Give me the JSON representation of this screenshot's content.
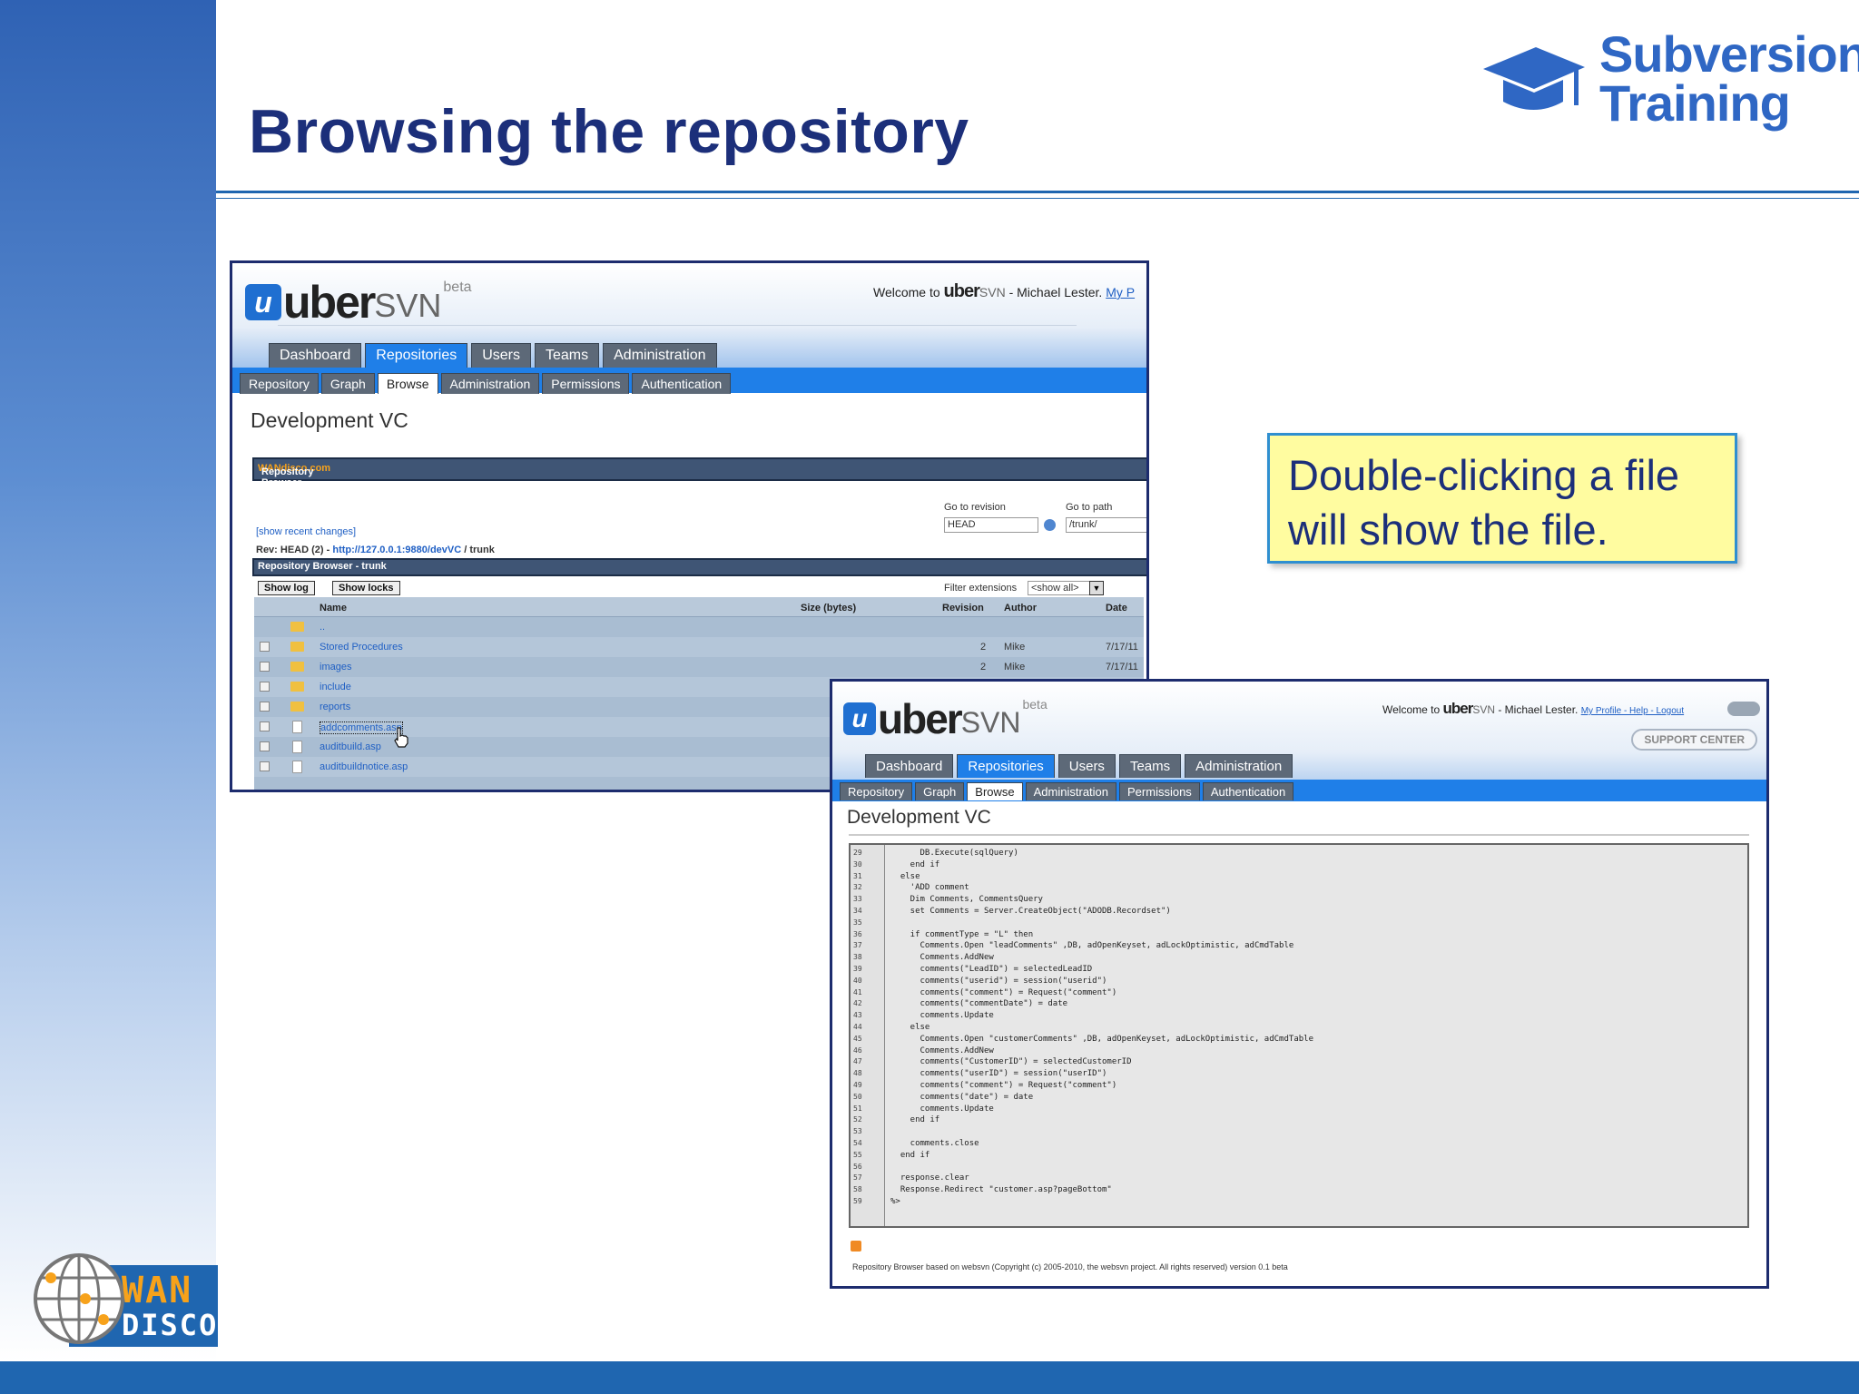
{
  "slide": {
    "title": "Browsing the repository",
    "brand_line1": "Subversion",
    "brand_line2": "Training",
    "wandisco_line1": "WAN",
    "wandisco_line2": "DISCO",
    "callout_line1": "Double-clicking a file",
    "callout_line2": "will show the file."
  },
  "colors": {
    "accent": "#1f66b0",
    "title": "#1c2f7a",
    "tab_active": "#1f7fe8",
    "callout_bg": "#fffca0"
  },
  "app": {
    "logo_u": "u",
    "logo_uber": "uber",
    "logo_svn": "SVN",
    "logo_beta": "beta",
    "welcome_prefix": "Welcome to ",
    "welcome_brand": "uber",
    "welcome_svn": "SVN",
    "welcome_user": " - Michael Lester.",
    "welcome_link": "My P",
    "welcome_links2": "My Profile - Help - Logout",
    "support": "SUPPORT CENTER",
    "main_tabs": [
      {
        "label": "Dashboard"
      },
      {
        "label": "Repositories"
      },
      {
        "label": "Users"
      },
      {
        "label": "Teams"
      },
      {
        "label": "Administration"
      }
    ],
    "sub_tabs": [
      {
        "label": "Repository"
      },
      {
        "label": "Graph"
      },
      {
        "label": "Browse"
      },
      {
        "label": "Administration"
      },
      {
        "label": "Permissions"
      },
      {
        "label": "Authentication"
      }
    ],
    "repo_name": "Development VC"
  },
  "browser": {
    "header": "Repository Browser - ",
    "header_link": "WANdisco.com",
    "go_revision_label": "Go to revision",
    "go_revision_value": "HEAD",
    "go_path_label": "Go to path",
    "go_path_value": "/trunk/",
    "show_recent": "[show recent changes]",
    "rev_prefix": "Rev: HEAD (2) - ",
    "rev_url": "http://127.0.0.1:9880/devVC",
    "rev_suffix": " / trunk",
    "trunk_header": "Repository Browser - trunk",
    "show_log": "Show log",
    "show_locks": "Show locks",
    "filter_label": "Filter extensions",
    "filter_value": "<show all>",
    "columns": {
      "name": "Name",
      "size": "Size (bytes)",
      "revision": "Revision",
      "author": "Author",
      "date": "Date"
    },
    "rows": [
      {
        "type": "folder",
        "name": "..",
        "revision": "",
        "author": "",
        "date": ""
      },
      {
        "type": "folder",
        "name": "Stored Procedures",
        "revision": "2",
        "author": "Mike",
        "date": "7/17/11"
      },
      {
        "type": "folder",
        "name": "images",
        "revision": "2",
        "author": "Mike",
        "date": "7/17/11"
      },
      {
        "type": "folder",
        "name": "include",
        "revision": "",
        "author": "",
        "date": ""
      },
      {
        "type": "folder",
        "name": "reports",
        "revision": "",
        "author": "",
        "date": ""
      },
      {
        "type": "file",
        "name": "addcomments.asp",
        "revision": "",
        "author": "",
        "date": ""
      },
      {
        "type": "file",
        "name": "auditbuild.asp",
        "revision": "",
        "author": "",
        "date": ""
      },
      {
        "type": "file",
        "name": "auditbuildnotice.asp",
        "revision": "",
        "author": "",
        "date": ""
      }
    ]
  },
  "viewer": {
    "lines": [
      {
        "n": "29",
        "t": "      DB.Execute(sqlQuery)"
      },
      {
        "n": "30",
        "t": "    end if"
      },
      {
        "n": "31",
        "t": "  else"
      },
      {
        "n": "32",
        "t": "    'ADD comment"
      },
      {
        "n": "33",
        "t": "    Dim Comments, CommentsQuery"
      },
      {
        "n": "34",
        "t": "    set Comments = Server.CreateObject(\"ADODB.Recordset\")"
      },
      {
        "n": "35",
        "t": ""
      },
      {
        "n": "36",
        "t": "    if commentType = \"L\" then"
      },
      {
        "n": "37",
        "t": "      Comments.Open \"leadComments\" ,DB, adOpenKeyset, adLockOptimistic, adCmdTable"
      },
      {
        "n": "38",
        "t": "      Comments.AddNew"
      },
      {
        "n": "39",
        "t": "      comments(\"LeadID\") = selectedLeadID"
      },
      {
        "n": "40",
        "t": "      comments(\"userid\") = session(\"userid\")"
      },
      {
        "n": "41",
        "t": "      comments(\"comment\") = Request(\"comment\")"
      },
      {
        "n": "42",
        "t": "      comments(\"commentDate\") = date"
      },
      {
        "n": "43",
        "t": "      comments.Update"
      },
      {
        "n": "44",
        "t": "    else"
      },
      {
        "n": "45",
        "t": "      Comments.Open \"customerComments\" ,DB, adOpenKeyset, adLockOptimistic, adCmdTable"
      },
      {
        "n": "46",
        "t": "      Comments.AddNew"
      },
      {
        "n": "47",
        "t": "      comments(\"CustomerID\") = selectedCustomerID"
      },
      {
        "n": "48",
        "t": "      comments(\"userID\") = session(\"userID\")"
      },
      {
        "n": "49",
        "t": "      comments(\"comment\") = Request(\"comment\")"
      },
      {
        "n": "50",
        "t": "      comments(\"date\") = date"
      },
      {
        "n": "51",
        "t": "      comments.Update"
      },
      {
        "n": "52",
        "t": "    end if"
      },
      {
        "n": "53",
        "t": ""
      },
      {
        "n": "54",
        "t": "    comments.close"
      },
      {
        "n": "55",
        "t": "  end if"
      },
      {
        "n": "56",
        "t": ""
      },
      {
        "n": "57",
        "t": "  response.clear"
      },
      {
        "n": "58",
        "t": "  Response.Redirect \"customer.asp?pageBottom\""
      },
      {
        "n": "59",
        "t": "%>"
      }
    ],
    "footer": "Repository Browser based on websvn (Copyright (c) 2005-2010, the websvn project. All rights reserved) version 0.1 beta"
  }
}
